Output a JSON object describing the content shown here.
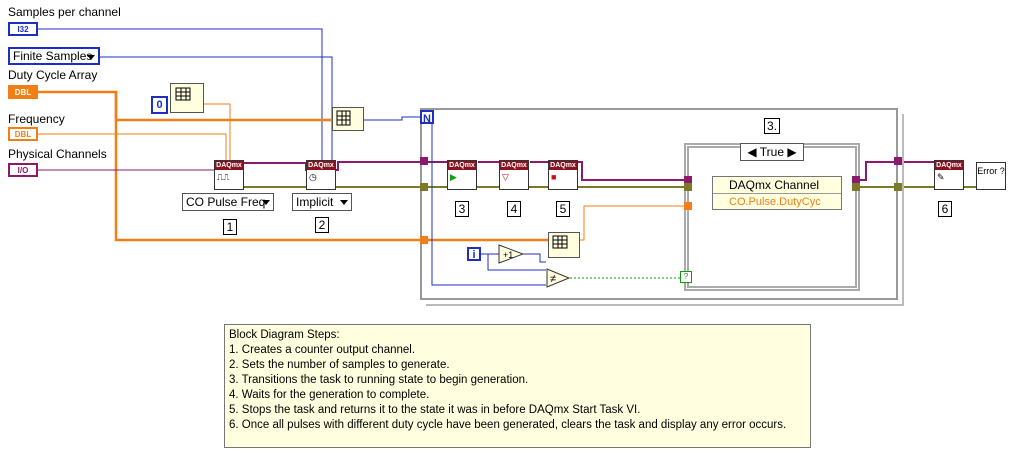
{
  "controls": {
    "samples_per_channel": {
      "label": "Samples per channel",
      "type": "I32"
    },
    "sample_mode": {
      "value": "Finite Samples"
    },
    "duty_cycle_array": {
      "label": "Duty Cycle Array",
      "type": "DBL"
    },
    "frequency": {
      "label": "Frequency",
      "type": "DBL"
    },
    "physical_channels": {
      "label": "Physical Channels",
      "type": "I/O"
    }
  },
  "constants": {
    "index_zero": "0",
    "co_pulse_freq": "CO Pulse Freq",
    "implicit": "Implicit",
    "case_selector": "True",
    "property_node_class": "DAQmx Channel",
    "property_node_prop": "CO.Pulse.DutyCyc",
    "loop_counter": "i",
    "loop_count": "N"
  },
  "vi_header": "DAQmx",
  "steps": {
    "s1": "1",
    "s2": "2",
    "s3": "3.",
    "s3b": "3",
    "s4": "4",
    "s5": "5",
    "s6": "6"
  },
  "error_indicator": "Error ?",
  "note": {
    "title": "Block Diagram Steps:",
    "lines": [
      "1. Creates a counter output channel.",
      "2. Sets the number of samples to generate.",
      "3. Transitions the task to running state to begin generation.",
      "4.  Waits for the generation to complete.",
      "5. Stops the task and returns it to the state it was in before DAQmx Start Task VI.",
      "6. Once all pulses with different duty cycle have been generated, clears the task and display any error occurs."
    ]
  },
  "colors": {
    "dbl_orange": "#f07f17",
    "int_blue": "#1c2fbf",
    "task_purple": "#8a1a6e",
    "error_olive": "#7a7a28",
    "bool_green": "#119911"
  }
}
